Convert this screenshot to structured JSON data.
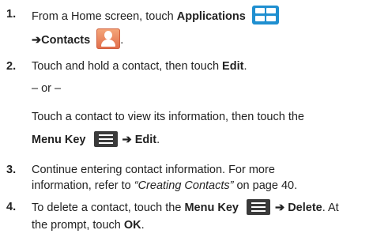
{
  "steps": [
    {
      "number": "1.",
      "text_a": "From a Home screen, touch ",
      "bold_a": "Applications",
      "arrow_b": "➔",
      "bold_b": "Contacts",
      "tail": "."
    },
    {
      "number": "2.",
      "text_a": "Touch and hold a contact, then touch ",
      "bold_a": "Edit",
      "tail": ".",
      "or": "– or –",
      "text_b": "Touch a contact to view its information, then touch the",
      "bold_b": "Menu Key",
      "arrow": "➔",
      "bold_c": "Edit",
      "tail_b": "."
    },
    {
      "number": "3.",
      "text_a": "Continue entering contact information. For more",
      "text_b": "information, refer to ",
      "italic_b": "“Creating Contacts”",
      "text_c": " on page 40."
    },
    {
      "number": "4.",
      "text_a": "To delete a contact, touch the ",
      "bold_a": "Menu Key",
      "arrow": "➔",
      "bold_b": "Delete",
      "text_b": ". At",
      "text_c": "the prompt, touch ",
      "bold_c": "OK",
      "tail": "."
    }
  ],
  "icons": {
    "applications": "applications-grid-icon",
    "contacts": "contacts-person-icon",
    "menu_key": "menu-key-icon"
  },
  "colors": {
    "text": "#222222",
    "applications_icon": "#1f8fd0",
    "contacts_icon": "#e06d4b",
    "menu_icon": "#3a3a3a"
  }
}
